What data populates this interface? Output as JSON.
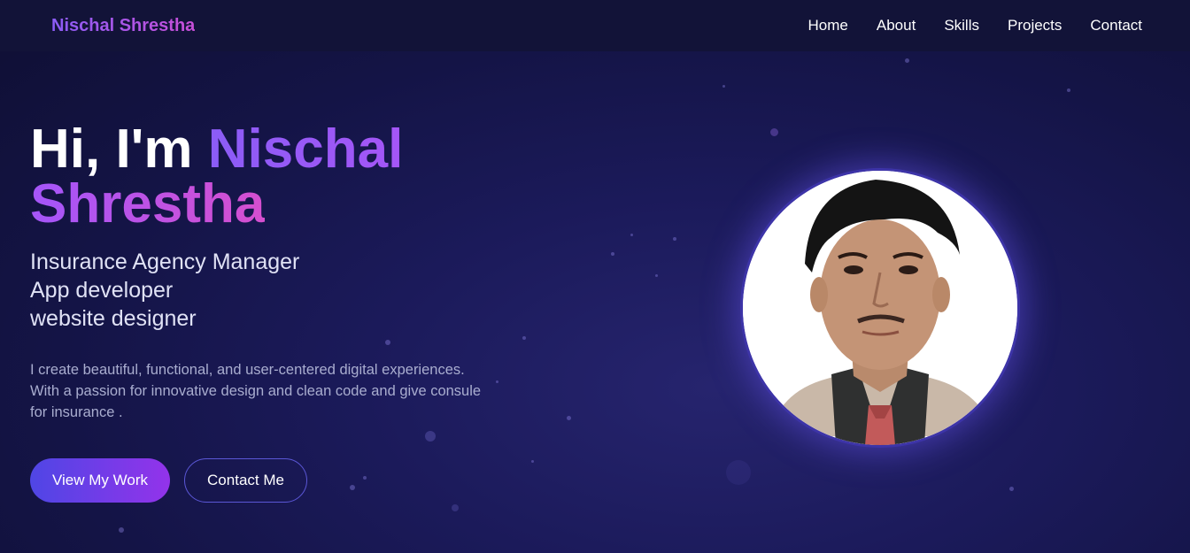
{
  "nav": {
    "brand": "Nischal Shrestha",
    "links": [
      "Home",
      "About",
      "Skills",
      "Projects",
      "Contact"
    ]
  },
  "hero": {
    "greeting": "Hi, I'm ",
    "name": "Nischal Shrestha",
    "roles": [
      "Insurance Agency Manager",
      "App developer",
      "website designer"
    ],
    "description": "I create beautiful, functional, and user-centered digital experiences. With a passion for innovative design and clean code and give consule for insurance .",
    "primary_button": "View My Work",
    "secondary_button": "Contact Me"
  },
  "colors": {
    "background": "#141446",
    "nav_background": "#121338",
    "accent_start": "#8b5cf6",
    "accent_end": "#d64fcf",
    "button_gradient_start": "#4f46e5",
    "button_gradient_end": "#9333ea"
  },
  "avatar": {
    "icon": "profile-photo"
  }
}
